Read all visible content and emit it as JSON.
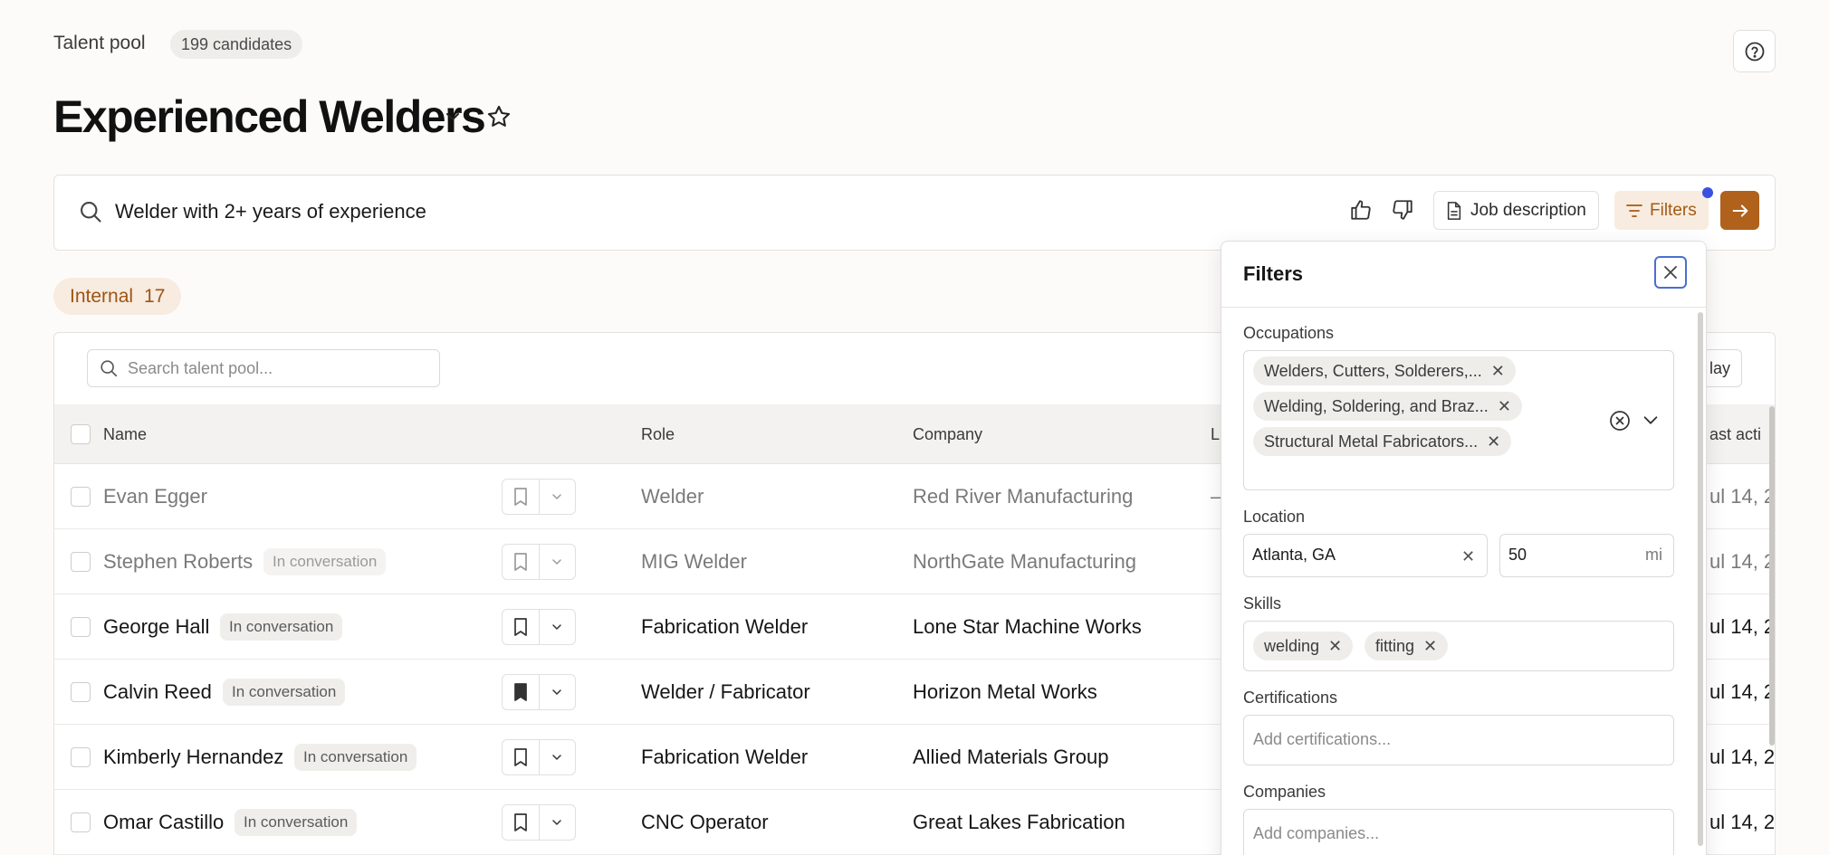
{
  "header": {
    "breadcrumb": "Talent pool",
    "candidate_count": "199 candidates",
    "title": "Experienced Welders"
  },
  "query": {
    "text": "Welder with 2+ years of experience",
    "job_description_label": "Job description",
    "filters_label": "Filters",
    "accent_color": "#b0611c",
    "dot_color": "#3b50e0"
  },
  "tab": {
    "label": "Internal",
    "count": "17"
  },
  "table": {
    "search_placeholder": "Search talent pool...",
    "display_label": "lay",
    "columns": {
      "name": "Name",
      "role": "Role",
      "company": "Company",
      "location": "L",
      "last_activity": "ast acti"
    },
    "rows": [
      {
        "name": "Evan Egger",
        "badge": "",
        "role": "Welder",
        "company": "Red River Manufacturing",
        "location": "–",
        "last": "ul 14, 2",
        "dim": true,
        "bookmarked": false
      },
      {
        "name": "Stephen Roberts",
        "badge": "In conversation",
        "role": "MIG Welder",
        "company": "NorthGate Manufacturing",
        "location": "",
        "last": "ul 14, 2",
        "dim": true,
        "bookmarked": false
      },
      {
        "name": "George Hall",
        "badge": "In conversation",
        "role": "Fabrication Welder",
        "company": "Lone Star Machine Works",
        "location": "",
        "last": "ul 14, 2",
        "dim": false,
        "bookmarked": false
      },
      {
        "name": "Calvin Reed",
        "badge": "In conversation",
        "role": "Welder / Fabricator",
        "company": "Horizon Metal Works",
        "location": "",
        "last": "ul 14, 2",
        "dim": false,
        "bookmarked": true
      },
      {
        "name": "Kimberly Hernandez",
        "badge": "In conversation",
        "role": "Fabrication Welder",
        "company": "Allied Materials Group",
        "location": "",
        "last": "ul 14, 2",
        "dim": false,
        "bookmarked": false
      },
      {
        "name": "Omar Castillo",
        "badge": "In conversation",
        "role": "CNC Operator",
        "company": "Great Lakes Fabrication",
        "location": "",
        "last": "ul 14, 2",
        "dim": false,
        "bookmarked": false
      }
    ]
  },
  "filters": {
    "title": "Filters",
    "occupations_label": "Occupations",
    "occupations": [
      "Welders, Cutters, Solderers,...",
      "Welding, Soldering, and Braz...",
      "Structural Metal Fabricators..."
    ],
    "location_label": "Location",
    "location_value": "Atlanta, GA",
    "radius_value": "50",
    "radius_unit": "mi",
    "skills_label": "Skills",
    "skills": [
      "welding",
      "fitting"
    ],
    "certifications_label": "Certifications",
    "certifications_placeholder": "Add certifications...",
    "companies_label": "Companies",
    "companies_placeholder": "Add companies..."
  }
}
